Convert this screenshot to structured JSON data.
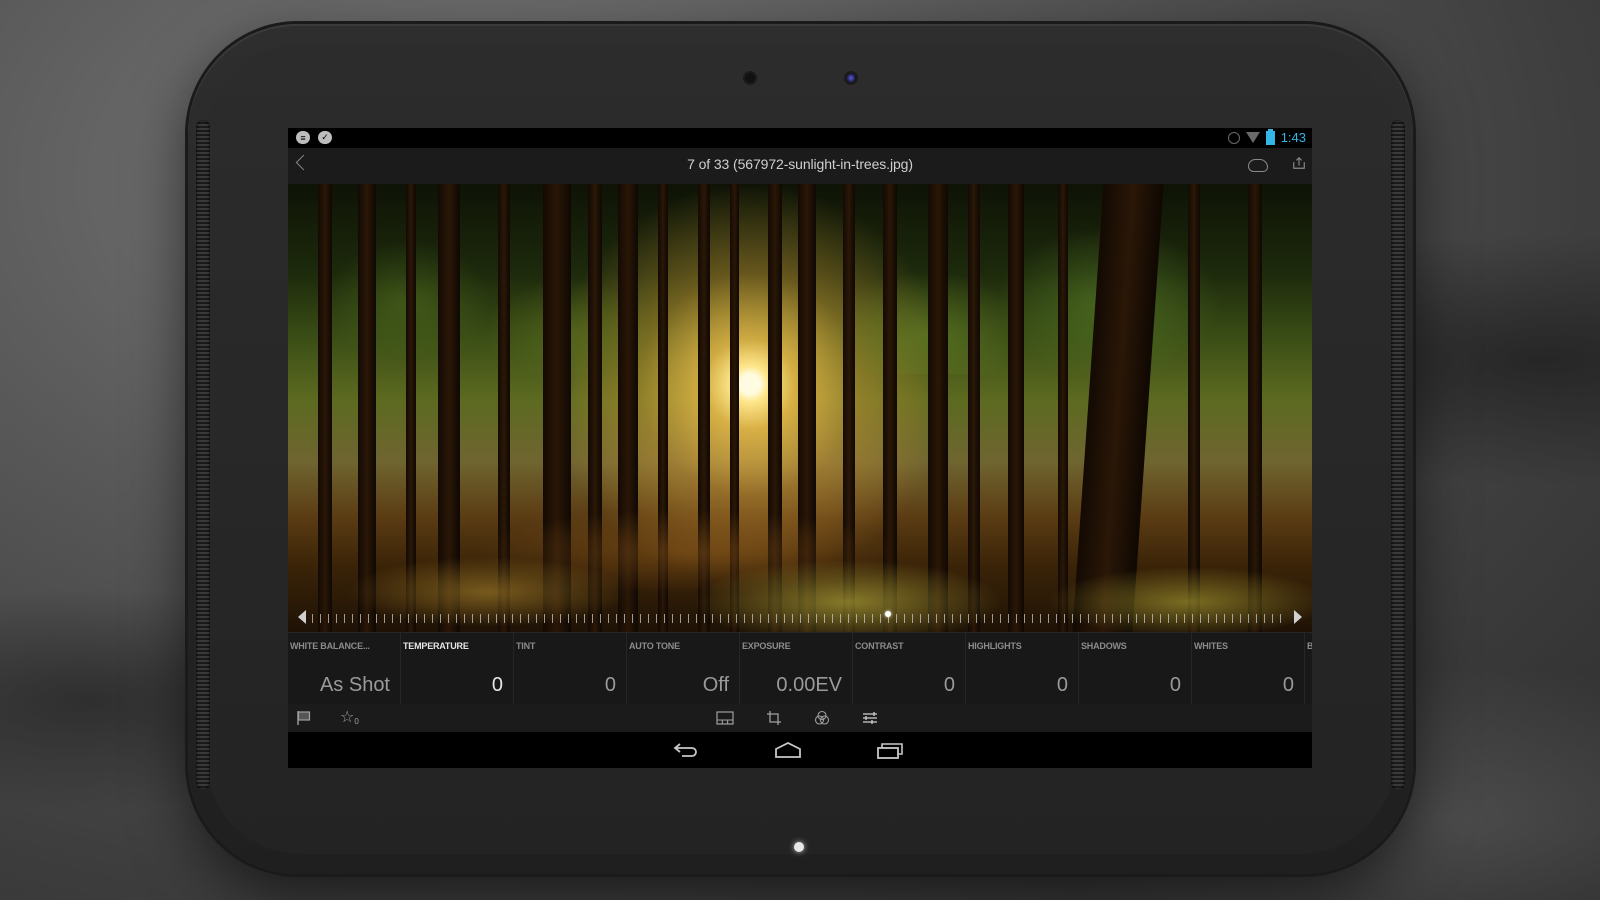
{
  "status_bar": {
    "notification_icons": [
      "chat-notification-icon",
      "checkmark-notification-icon"
    ],
    "system_icons": [
      "alarm-icon",
      "wifi-icon",
      "battery-charging-icon"
    ],
    "time": "1:43",
    "accent_color": "#33b5e5"
  },
  "action_bar": {
    "back_icon": "chevron-left-icon",
    "title": "7 of 33 (567972-sunlight-in-trees.jpg)",
    "actions": [
      "cloud-sync-icon",
      "share-icon"
    ]
  },
  "photo": {
    "description": "Sunlight shining through trees in a forest",
    "scrubber_position": 0.59
  },
  "adjustments": [
    {
      "label": "WHITE BALANCE...",
      "value": "As Shot",
      "active": false
    },
    {
      "label": "TEMPERATURE",
      "value": "0",
      "active": true
    },
    {
      "label": "TINT",
      "value": "0",
      "active": false
    },
    {
      "label": "AUTO TONE",
      "value": "Off",
      "active": false
    },
    {
      "label": "EXPOSURE",
      "value": "0.00EV",
      "active": false
    },
    {
      "label": "CONTRAST",
      "value": "0",
      "active": false
    },
    {
      "label": "HIGHLIGHTS",
      "value": "0",
      "active": false
    },
    {
      "label": "SHADOWS",
      "value": "0",
      "active": false
    },
    {
      "label": "WHITES",
      "value": "0",
      "active": false
    },
    {
      "label": "B",
      "value": "",
      "active": false
    }
  ],
  "toolbar": {
    "left": [
      "flag-icon",
      "star-rating-icon"
    ],
    "star_count": "0",
    "right": [
      "filmstrip-icon",
      "crop-icon",
      "presets-icon",
      "adjustments-icon"
    ]
  },
  "nav_bar": [
    "back-nav-icon",
    "home-nav-icon",
    "recent-apps-icon"
  ]
}
